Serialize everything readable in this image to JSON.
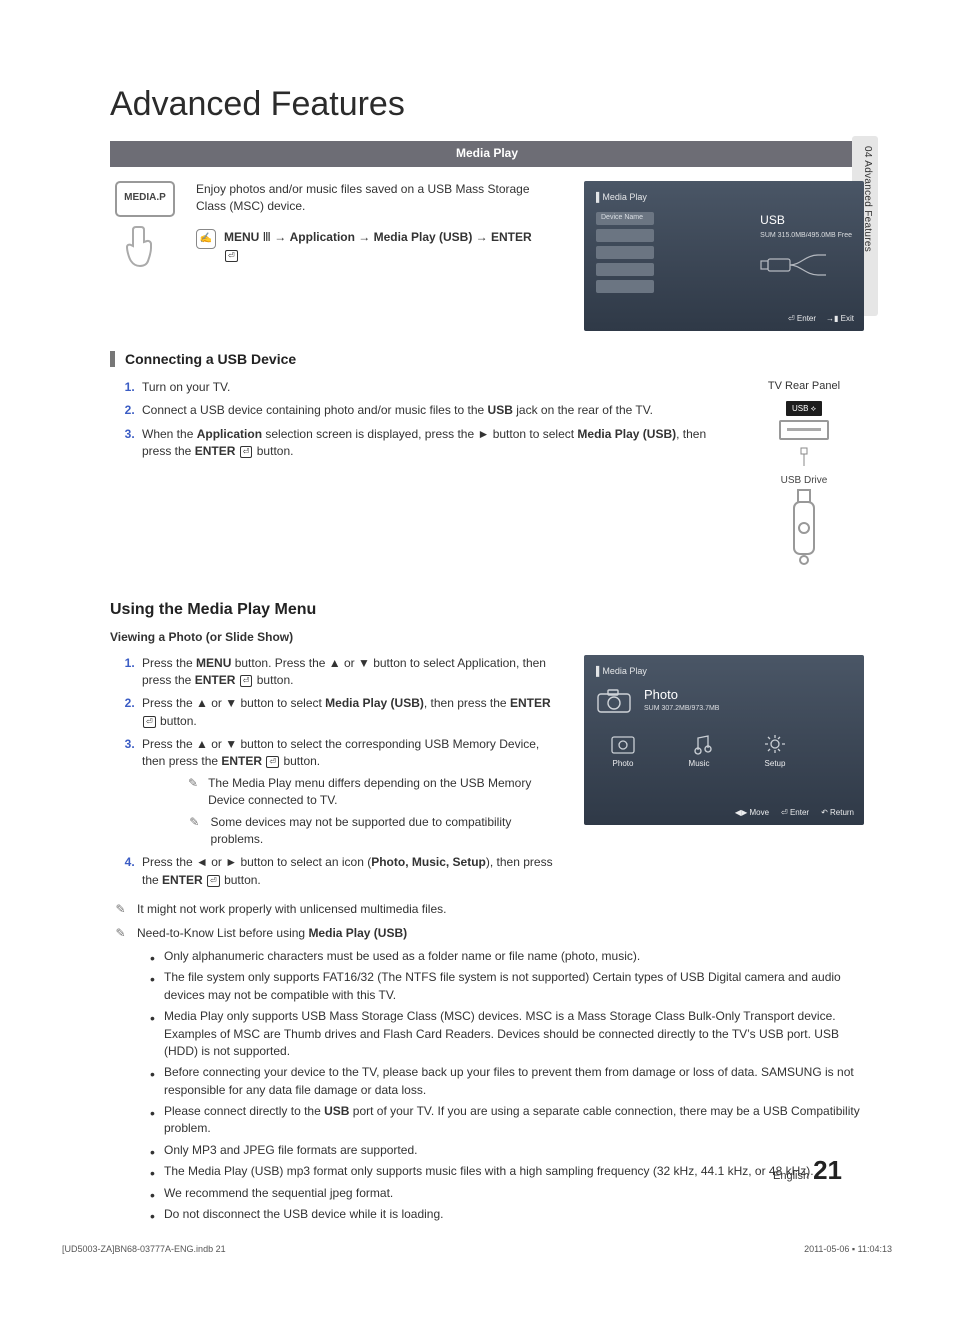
{
  "side_tab": "04   Advanced Features",
  "title": "Advanced Features",
  "bar_title": "Media Play",
  "intro_text": "Enjoy photos and/or music files saved on a USB Mass Storage Class (MSC) device.",
  "mediap_label": "MEDIA.P",
  "menu_path_html": "MENU Ⅲ → Application → Media Play (USB) → ENTER",
  "tv1": {
    "screen_title": "▌Media Play",
    "device_name_label": "Device Name",
    "usb_label": "USB",
    "usb_sub": "SUM\n315.0MB/495.0MB Free",
    "footer": {
      "enter": "⏎ Enter",
      "exit": "→▮ Exit"
    }
  },
  "section1_title": "Connecting a USB Device",
  "conn_steps": [
    "Turn on your TV.",
    "Connect a USB device containing photo and/or music files to the USB jack on the rear of the TV.",
    "When the Application selection screen is displayed, press the ► button to select Media Play (USB), then press the ENTER ⏎ button."
  ],
  "rear_panel_label": "TV Rear Panel",
  "usb_port_label": "USB ⟡",
  "usb_drive_label": "USB Drive",
  "section2_title": "Using the Media Play Menu",
  "viewing_head": "Viewing a Photo (or Slide Show)",
  "view_steps": [
    "Press the MENU button. Press the ▲ or ▼ button to select Application, then press the ENTER ⏎ button.",
    "Press the ▲ or ▼ button to select Media Play (USB), then press the ENTER ⏎ button.",
    "Press the ▲ or ▼ button to select the corresponding USB Memory Device, then press the ENTER ⏎ button.",
    "Press the ◄ or ► button to select an icon (Photo, Music, Setup), then press the ENTER ⏎ button."
  ],
  "view_notes_after3": [
    "The Media Play menu differs depending on the USB Memory Device connected to TV.",
    "Some devices may not be supported due to compatibility problems."
  ],
  "tv2": {
    "screen_title": "▌Media Play",
    "photo_label": "Photo",
    "photo_sub": "SUM\n307.2MB/973.7MB",
    "icons": [
      "Photo",
      "Music",
      "Setup"
    ],
    "footer": {
      "move": "◀▶ Move",
      "enter": "⏎ Enter",
      "return": "↶ Return"
    }
  },
  "note_unlicensed": "It might not work properly with unlicensed multimedia files.",
  "note_needtoknow_head": "Need-to-Know List before using Media Play (USB)",
  "needtoknow": [
    "Only alphanumeric characters must be used as a folder name or file name (photo, music).",
    "The file system only supports FAT16/32 (The NTFS file system is not supported) Certain types of USB Digital camera and audio devices may not be compatible with this TV.",
    "Media Play only supports USB Mass Storage Class (MSC) devices. MSC is a Mass Storage Class Bulk-Only Transport device. Examples of MSC are Thumb drives and Flash Card Readers. Devices should be connected directly to the TV’s USB port. USB (HDD) is not supported.",
    "Before connecting your device to the TV, please back up your files to prevent them from damage or loss of data. SAMSUNG is not responsible for any data file damage or data loss.",
    "Please connect directly to the USB port of your TV. If you are using a separate cable connection, there may be a USB Compatibility problem.",
    "Only MP3 and JPEG file formats are supported.",
    "The Media Play (USB) mp3 format only supports music files with a high sampling frequency (32 kHz, 44.1 kHz, or 48 kHz).",
    "We recommend the sequential jpeg format.",
    "Do not disconnect the USB device while it is loading."
  ],
  "page_footer": {
    "lang": "English",
    "num": "21"
  },
  "meta_left": "[UD5003-ZA]BN68-03777A-ENG.indb   21",
  "meta_right": "2011-05-06   ▪ 11:04:13"
}
